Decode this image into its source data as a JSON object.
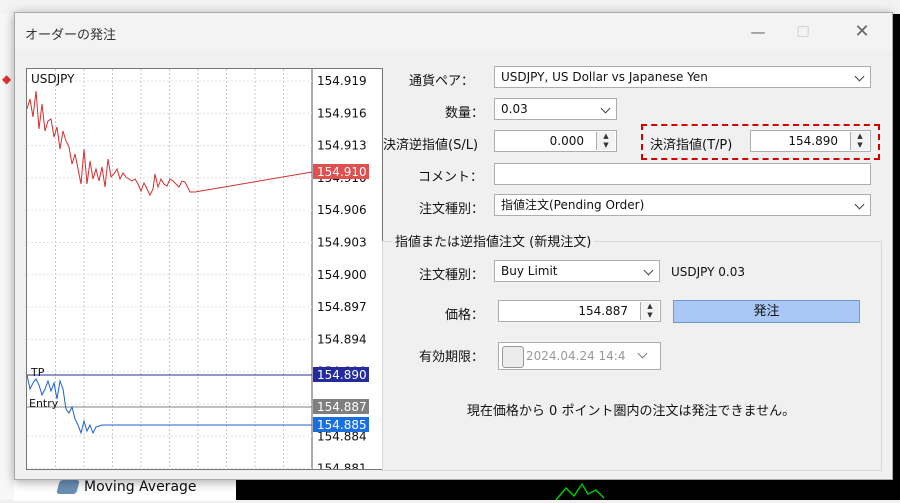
{
  "dialog": {
    "title": "オーダーの発注"
  },
  "chart": {
    "symbol": "USDJPY",
    "price_labels": [
      "154.919",
      "154.916",
      "154.913",
      "154.910",
      "154.906",
      "154.903",
      "154.900",
      "154.897",
      "154.894",
      "154.890",
      "154.887",
      "154.884",
      "154.881"
    ],
    "markers": {
      "current": {
        "label": "154.910",
        "color": "#e05050"
      },
      "tp": {
        "label": "154.890",
        "tag": "TP",
        "color": "#242c9c"
      },
      "entry": {
        "label": "154.887",
        "tag": "Entry",
        "color": "#7f7f7f"
      },
      "bid": {
        "label": "154.885",
        "color": "#1a6fe0"
      }
    }
  },
  "form": {
    "symbol_label": "通貨ペア：",
    "symbol_value": "USDJPY, US Dollar vs Japanese Yen",
    "volume_label": "数量：",
    "volume_value": "0.03",
    "sl_label": "決済逆指値(S/L)",
    "sl_value": "0.000",
    "tp_label": "決済指値(T/P)",
    "tp_value": "154.890",
    "comment_label": "コメント：",
    "comment_value": "",
    "order_type_label": "注文種別：",
    "order_type_value": "指値注文(Pending Order)"
  },
  "pending": {
    "group_title": "指値または逆指値注文 (新規注文)",
    "type_label": "注文種別：",
    "type_value": "Buy Limit",
    "info": "USDJPY 0.03",
    "price_label": "価格：",
    "price_value": "154.887",
    "send_button": "発注",
    "expiry_label": "有効期限：",
    "expiry_value": "2024.04.24 14:4",
    "message": "現在価格から 0 ポイント圏内の注文は発注できません。"
  },
  "background": {
    "navigator_item": "Moving Average"
  }
}
